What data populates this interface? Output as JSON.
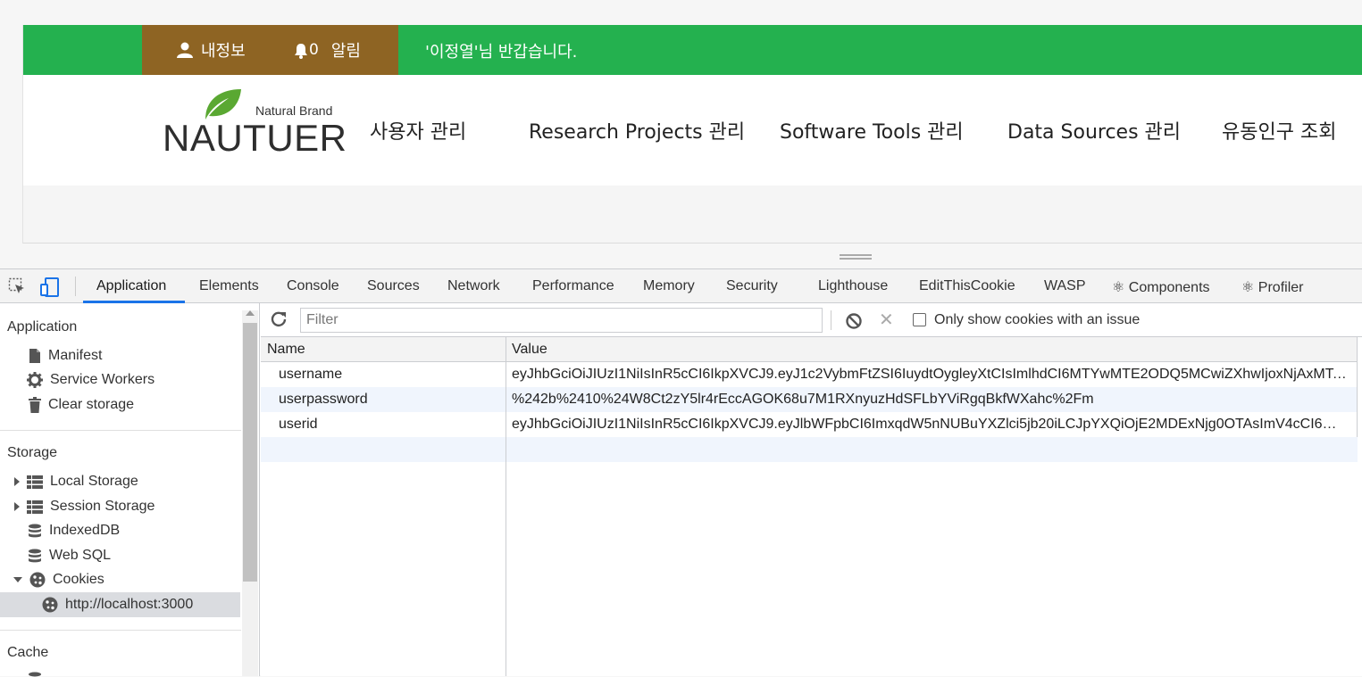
{
  "site": {
    "topbar": {
      "myinfo_label": "내정보",
      "alarm_count": "0",
      "alarm_label": "알림",
      "greeting": "'이정열'님 반갑습니다."
    },
    "logo": {
      "sub": "Natural Brand",
      "main": "NAUTUER"
    },
    "nav": [
      "사용자 관리",
      "Research Projects 관리",
      "Software Tools 관리",
      "Data Sources 관리",
      "유동인구 조회"
    ],
    "colors": {
      "topbar_green": "#24b14f",
      "user_brown": "#8e6423",
      "leaf_green": "#5aa832"
    }
  },
  "devtools": {
    "tabs": [
      "Application",
      "Elements",
      "Console",
      "Sources",
      "Network",
      "Performance",
      "Memory",
      "Security",
      "Lighthouse",
      "EditThisCookie",
      "WASP",
      "⚛ Components",
      "⚛ Profiler"
    ],
    "active_tab": "Application",
    "sidebar": {
      "application_header": "Application",
      "application_items": [
        "Manifest",
        "Service Workers",
        "Clear storage"
      ],
      "storage_header": "Storage",
      "storage_items": [
        "Local Storage",
        "Session Storage",
        "IndexedDB",
        "Web SQL",
        "Cookies"
      ],
      "cookie_origin": "http://localhost:3000",
      "cache_header": "Cache"
    },
    "toolbar": {
      "filter_placeholder": "Filter",
      "only_issues_label": "Only show cookies with an issue"
    },
    "table": {
      "headers": {
        "name": "Name",
        "value": "Value"
      },
      "rows": [
        {
          "name": "username",
          "value": "eyJhbGciOiJIUzI1NiIsInR5cCI6IkpXVCJ9.eyJ1c2VybmFtZSI6IuydtOygleyXtCIsImlhdCI6MTYwMTE2ODQ5MCwiZXhwIjoxNjAxMTcy..."
        },
        {
          "name": "userpassword",
          "value": "%242b%2410%24W8Ct2zY5lr4rEccAGOK68u7M1RXnyuzHdSFLbYViRgqBkfWXahc%2Fm"
        },
        {
          "name": "userid",
          "value": "eyJhbGciOiJIUzI1NiIsInR5cCI6IkpXVCJ9.eyJlbWFpbCI6ImxqdW5nNUBuYXZlci5jb20iLCJpYXQiOjE2MDExNjg0OTAsImV4cCI6MTYw..."
        }
      ]
    },
    "colors": {
      "accent": "#1a73e8",
      "row_alt": "#f0f5fd",
      "selected": "#dadce0"
    }
  }
}
